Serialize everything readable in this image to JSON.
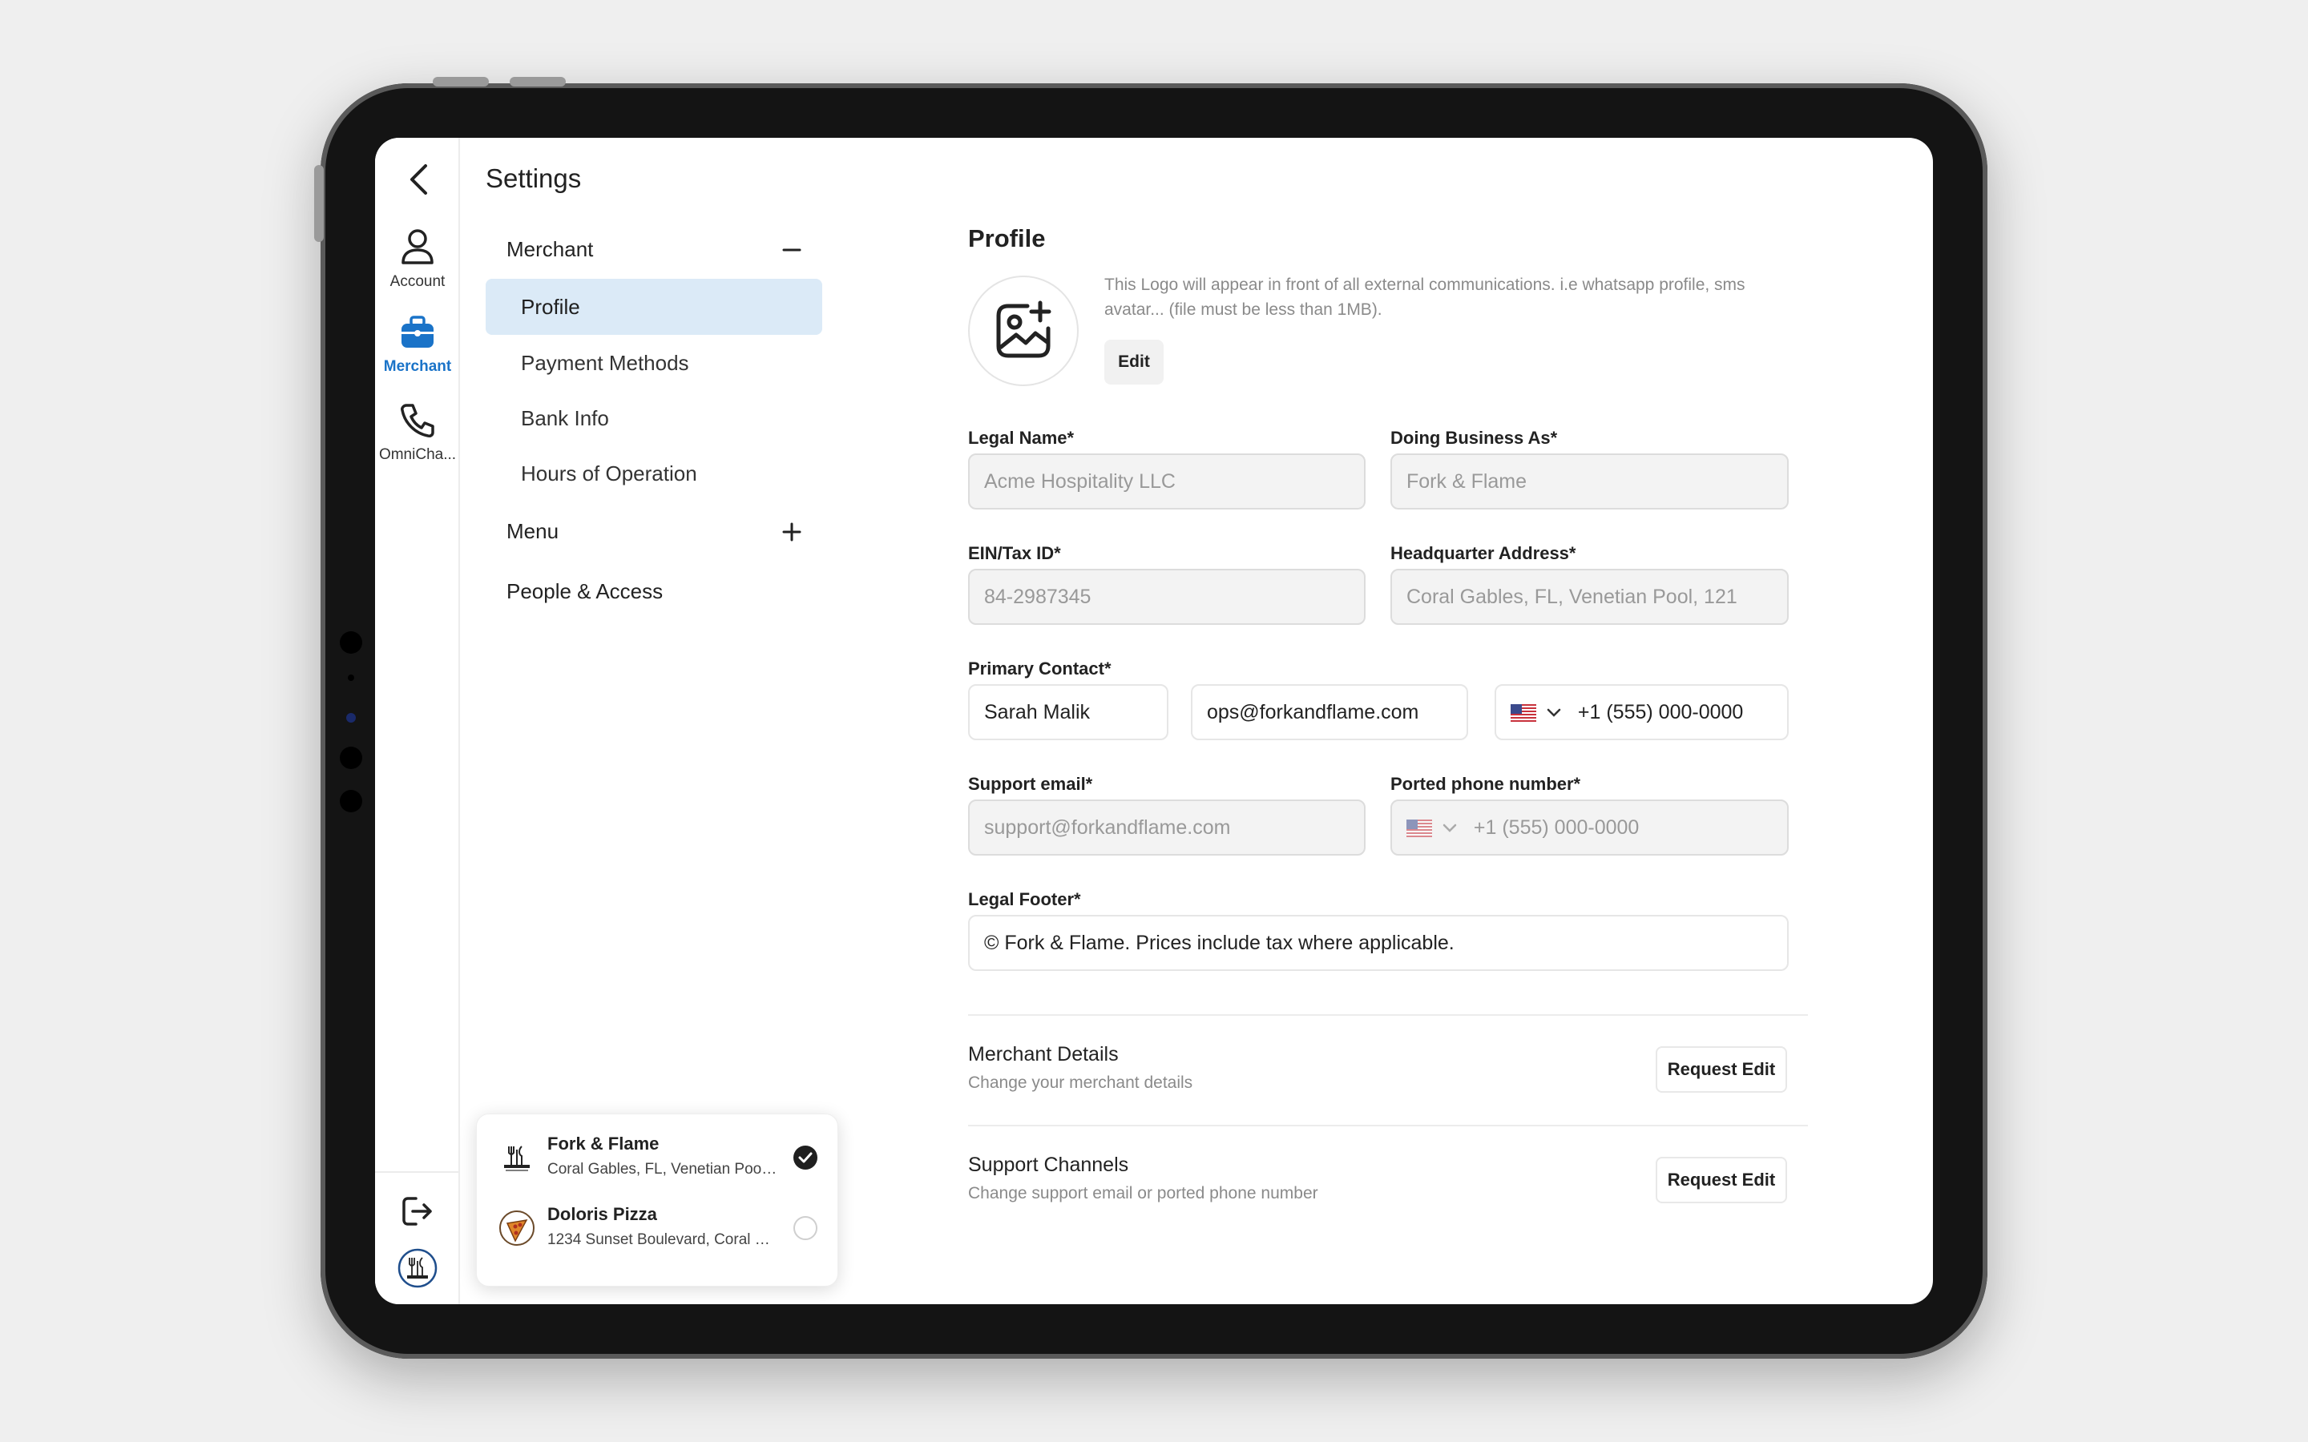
{
  "rail": {
    "items": [
      {
        "label": "Account",
        "icon": "user-icon"
      },
      {
        "label": "Merchant",
        "icon": "briefcase-icon",
        "active": true
      },
      {
        "label": "OmniCha...",
        "icon": "phone-icon"
      }
    ]
  },
  "settings": {
    "title": "Settings",
    "groups": {
      "merchant": "Merchant",
      "menu": "Menu",
      "people": "People & Access"
    },
    "merchant_items": [
      "Profile",
      "Payment Methods",
      "Bank Info",
      "Hours of Operation"
    ]
  },
  "switcher": {
    "merchants": [
      {
        "name": "Fork & Flame",
        "address": "Coral Gables, FL, Venetian Pool,...",
        "selected": true
      },
      {
        "name": "Doloris Pizza",
        "address": "1234 Sunset Boulevard, Coral Ga...",
        "selected": false
      }
    ]
  },
  "profile": {
    "title": "Profile",
    "logo_description": "This Logo will appear in front of all external communications. i.e whatsapp profile, sms avatar... (file must be less than 1MB).",
    "edit_label": "Edit",
    "fields": {
      "legal_name": {
        "label": "Legal Name*",
        "value": "Acme Hospitality LLC"
      },
      "dba": {
        "label": "Doing Business As*",
        "value": "Fork & Flame"
      },
      "ein": {
        "label": "EIN/Tax ID*",
        "value": "84-2987345"
      },
      "hq": {
        "label": "Headquarter Address*",
        "value": "Coral Gables, FL, Venetian Pool, 121"
      },
      "primary_contact": {
        "label": "Primary Contact*",
        "name": "Sarah Malik",
        "email": "ops@forkandflame.com",
        "phone": "+1 (555) 000-0000"
      },
      "support_email": {
        "label": "Support email*",
        "value": "support@forkandflame.com"
      },
      "ported_phone": {
        "label": "Ported phone number*",
        "value": "+1 (555) 000-0000"
      },
      "legal_footer": {
        "label": "Legal Footer*",
        "value": "© Fork & Flame. Prices include tax where applicable."
      }
    },
    "sections": [
      {
        "title": "Merchant Details",
        "subtitle": "Change your merchant details",
        "button": "Request Edit"
      },
      {
        "title": "Support Channels",
        "subtitle": "Change support email or ported phone number",
        "button": "Request Edit"
      }
    ]
  },
  "colors": {
    "accent": "#1a73c8",
    "active_bg": "#dbeaf7"
  }
}
